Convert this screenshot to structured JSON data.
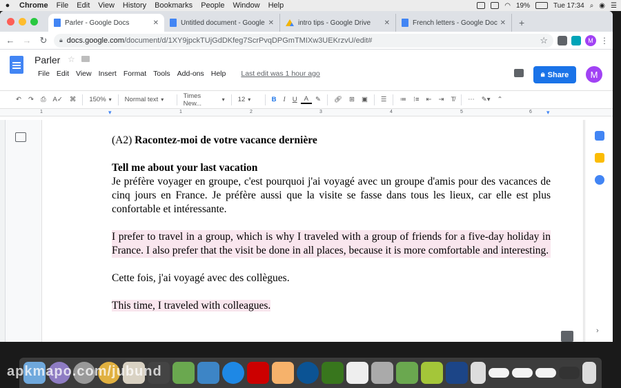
{
  "mac_menubar": {
    "app": "Chrome",
    "items": [
      "File",
      "Edit",
      "View",
      "History",
      "Bookmarks",
      "People",
      "Window",
      "Help"
    ],
    "battery": "19%",
    "clock": "Tue 17:34"
  },
  "browser": {
    "tabs": [
      {
        "label": "Parler - Google Docs",
        "icon": "docs-icon"
      },
      {
        "label": "Untitled document - Google Do",
        "icon": "docs-icon"
      },
      {
        "label": "intro tips - Google Drive",
        "icon": "drive-icon"
      },
      {
        "label": "French letters - Google Docs",
        "icon": "docs-icon"
      }
    ],
    "url_host": "docs.google.com",
    "url_path": "/document/d/1XY9jpckTUjGdDKfeg7ScrPvqDPGmTMIXw3UEKrzvU/edit#",
    "profile_initial": "M"
  },
  "docs": {
    "title": "Parler",
    "menu": [
      "File",
      "Edit",
      "View",
      "Insert",
      "Format",
      "Tools",
      "Add-ons",
      "Help"
    ],
    "last_edit": "Last edit was 1 hour ago",
    "share_label": "Share",
    "avatar_initial": "M",
    "toolbar": {
      "zoom": "150%",
      "style": "Normal text",
      "font": "Times New...",
      "size": "12",
      "bold": "B",
      "italic": "I",
      "underline": "U",
      "text_color": "A"
    },
    "ruler_numbers": [
      "1",
      "1",
      "2",
      "3",
      "4",
      "5",
      "6"
    ]
  },
  "document": {
    "heading_prefix": "(A2) ",
    "heading_bold": "Racontez-moi de votre vacance dernière",
    "subheading": "Tell me about your last vacation",
    "para_fr_1": "Je préfère voyager en groupe, c'est pourquoi j'ai voyagé avec un groupe d'amis pour des vacances de cinq jours en France. Je préfère aussi que la visite se fasse dans tous les lieux, car elle est plus confortable et intéressante.",
    "para_en_1": "I prefer to travel in a group, which is why I traveled with a group of friends for a five-day holiday in France. I also prefer that the visit be done in all places, because it is more comfortable and interesting.",
    "para_fr_2": "Cette fois, j'ai voyagé avec des collègues.",
    "para_en_2": "This time, I traveled with colleagues."
  },
  "watermark": "apkmapo.com/jubund",
  "colors": {
    "share_blue": "#1a73e8",
    "highlight": "#f9e6ee",
    "avatar_purple": "#a142f4"
  }
}
